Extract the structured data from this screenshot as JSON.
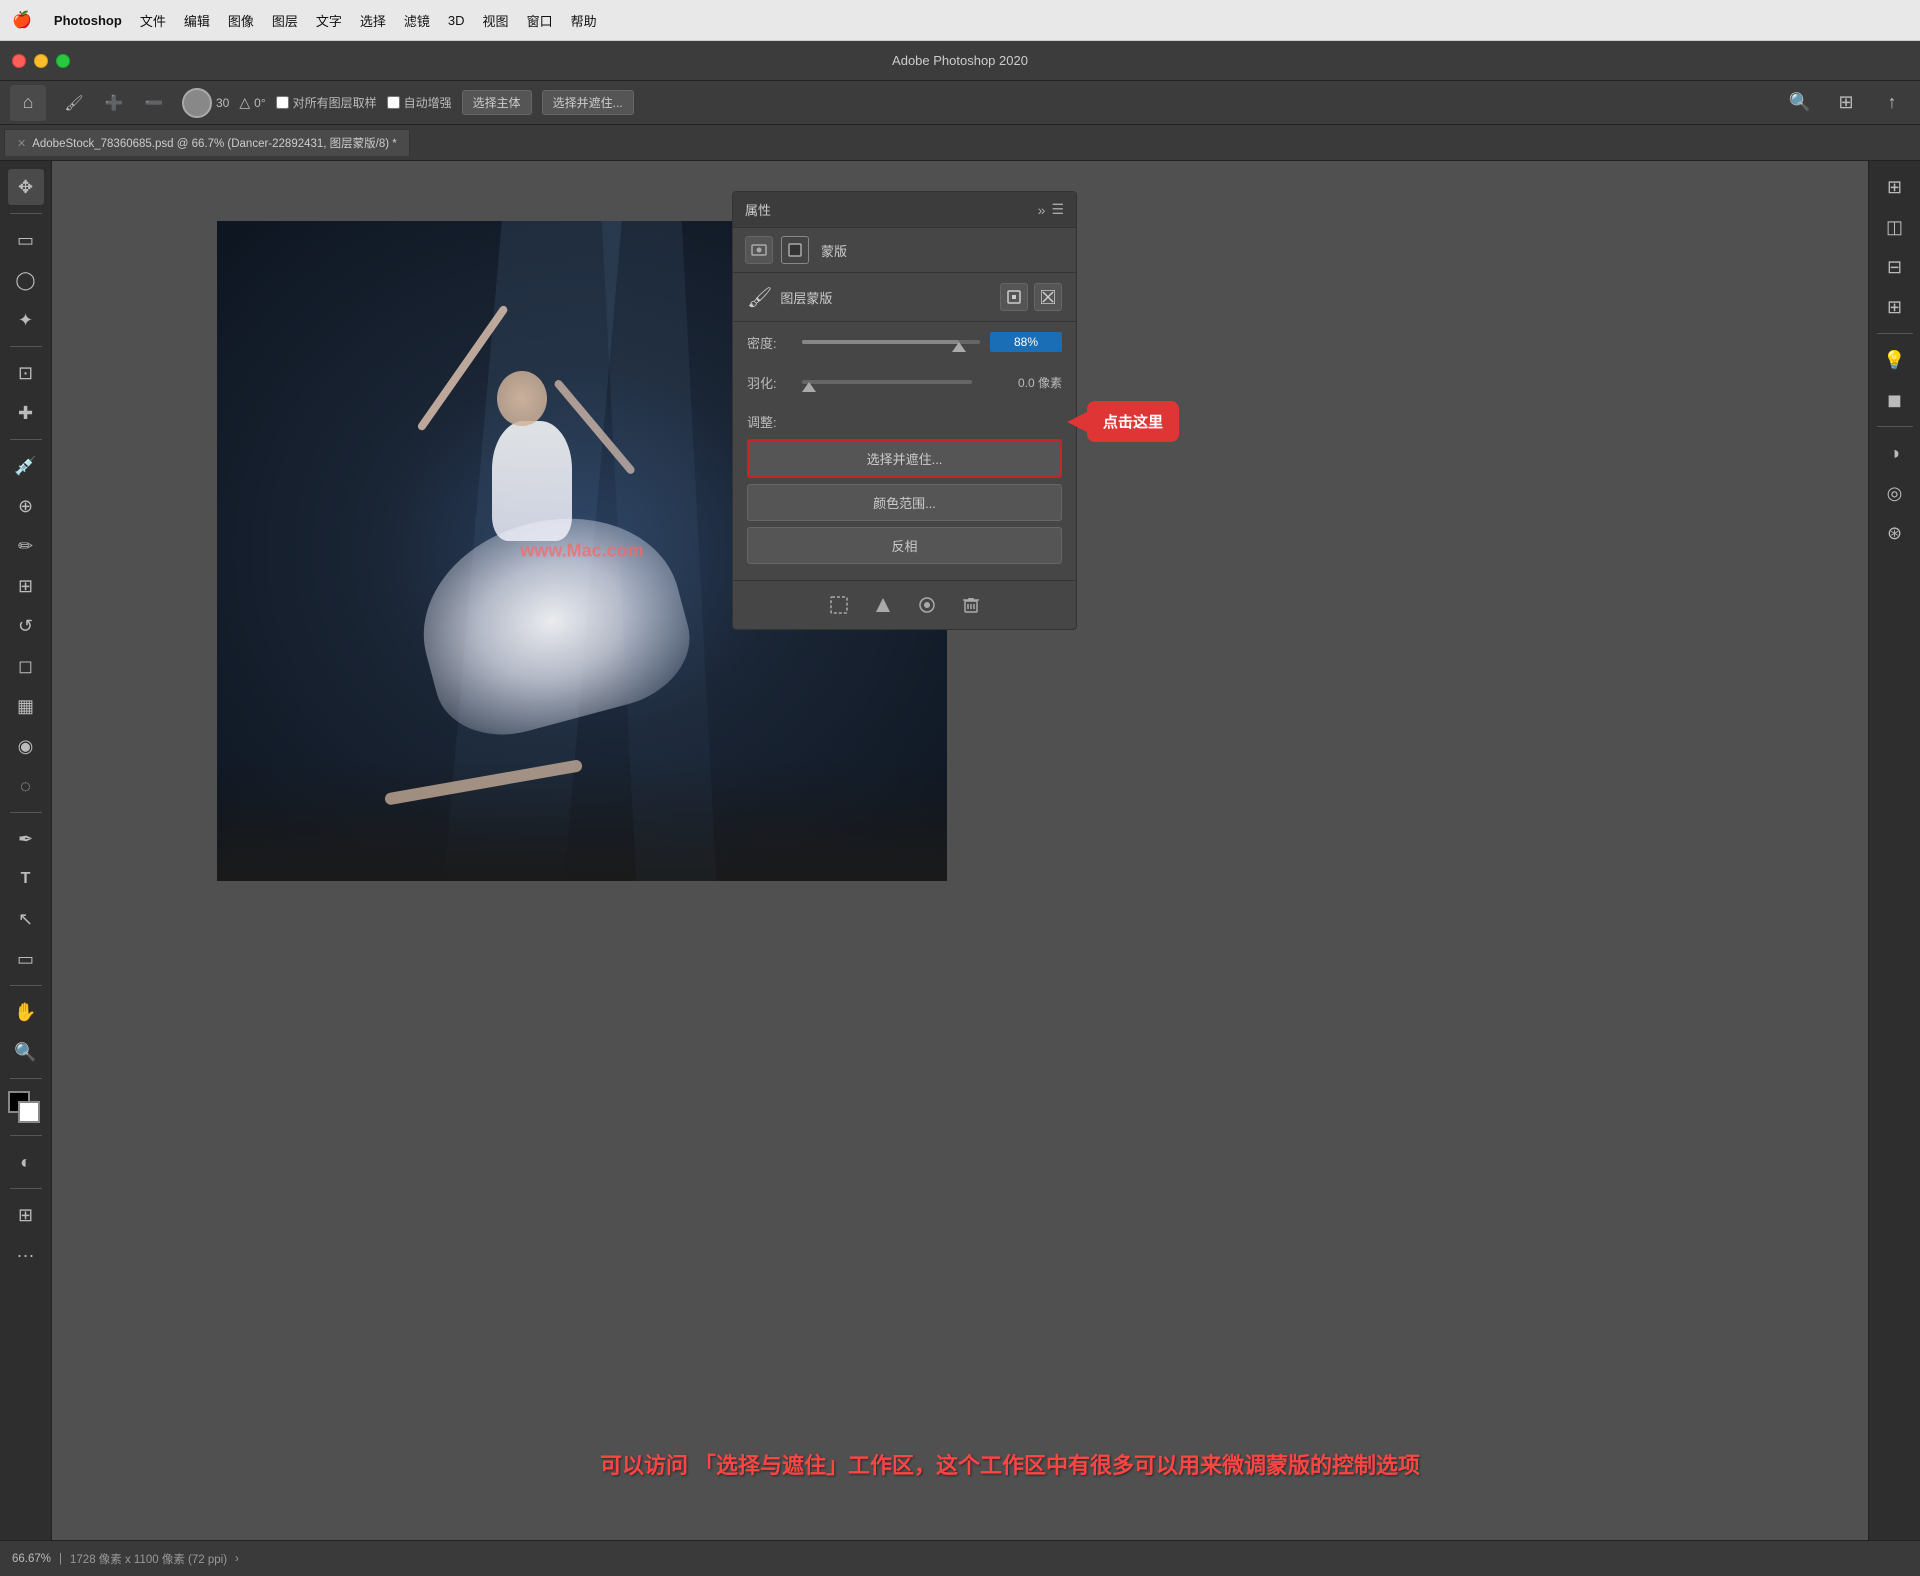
{
  "menubar": {
    "apple": "🍎",
    "app_name": "Photoshop",
    "menus": [
      "文件",
      "编辑",
      "图像",
      "图层",
      "文字",
      "选择",
      "滤镜",
      "3D",
      "视图",
      "窗口",
      "帮助"
    ]
  },
  "titlebar": {
    "title": "Adobe Photoshop 2020"
  },
  "optionsbar": {
    "brush_size": "30",
    "angle": "0°",
    "sample_all_label": "对所有图层取样",
    "auto_enhance_label": "自动增强",
    "select_subject_btn": "选择主体",
    "select_mask_btn": "选择并遮住..."
  },
  "tabbar": {
    "tab_label": "AdobeStock_78360685.psd @ 66.7% (Dancer-22892431, 图层蒙版/8) *"
  },
  "properties_panel": {
    "title": "属性",
    "tab_mask": "蒙版",
    "section_title": "图层蒙版",
    "density_label": "密度:",
    "density_value": "88%",
    "feather_label": "羽化:",
    "feather_value": "0.0 像素",
    "adjust_label": "调整:",
    "btn_select_mask": "选择并遮住...",
    "btn_color_range": "颜色范围...",
    "btn_invert": "反相"
  },
  "callout": {
    "text": "点击这里"
  },
  "annotation": {
    "text": "可以访问 「选择与遮住」工作区，这个工作区中有很多可以用来微调蒙版的控制选项"
  },
  "statusbar": {
    "zoom": "66.67%",
    "size": "1728 像素 x 1100 像素 (72 ppi)"
  },
  "watermark": {
    "text": "www.Mac.com"
  },
  "icons": {
    "home": "⌂",
    "move": "✥",
    "select_rect": "▭",
    "lasso": "⌒",
    "magic_wand": "✦",
    "crop": "⊡",
    "eyedropper": "💉",
    "healing": "✚",
    "brush": "✏",
    "stamp": "⊕",
    "eraser": "◻",
    "gradient": "▦",
    "blur": "◉",
    "dodge": "◯",
    "pen": "✒",
    "text": "T",
    "arrow": "↖",
    "shape": "▭",
    "hand": "✋",
    "zoom": "🔍",
    "extras": "···"
  }
}
